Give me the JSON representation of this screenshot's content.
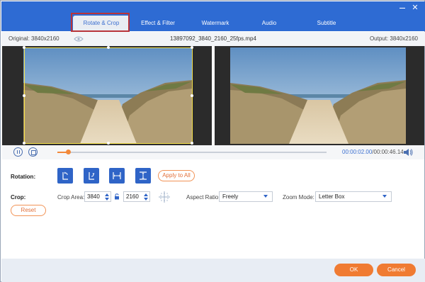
{
  "window": {
    "controls": {
      "minimize_icon": "minimize-icon",
      "close_symbol": "✕"
    }
  },
  "tabs": [
    {
      "label": "Rotate & Crop",
      "active": true
    },
    {
      "label": "Effect & Filter",
      "active": false
    },
    {
      "label": "Watermark",
      "active": false
    },
    {
      "label": "Audio",
      "active": false
    },
    {
      "label": "Subtitle",
      "active": false
    }
  ],
  "infobar": {
    "original": "Original: 3840x2160",
    "filename": "13897092_3840_2160_25fps.mp4",
    "output": "Output: 3840x2160"
  },
  "player": {
    "current_time": "00:00:02.00",
    "total_time": "/00:00:46.14",
    "progress": 0.04
  },
  "rotation": {
    "label": "Rotation:",
    "buttons": [
      {
        "name": "rotate-left-icon"
      },
      {
        "name": "rotate-right-icon"
      },
      {
        "name": "flip-horizontal-icon"
      },
      {
        "name": "flip-vertical-icon"
      }
    ],
    "apply_all": "Apply to All"
  },
  "crop": {
    "label": "Crop:",
    "crop_area_label": "Crop Area:",
    "width": "3840",
    "height": "2160",
    "aspect_ratio_label": "Aspect Ratio:",
    "aspect_ratio_value": "Freely",
    "zoom_mode_label": "Zoom Mode:",
    "zoom_mode_value": "Letter Box",
    "reset": "Reset"
  },
  "footer": {
    "ok": "OK",
    "cancel": "Cancel"
  },
  "colors": {
    "header": "#2e6bd3",
    "accent_orange": "#f07b32",
    "tab_highlight": "#b9343a",
    "crop_border": "#f4e04a"
  }
}
